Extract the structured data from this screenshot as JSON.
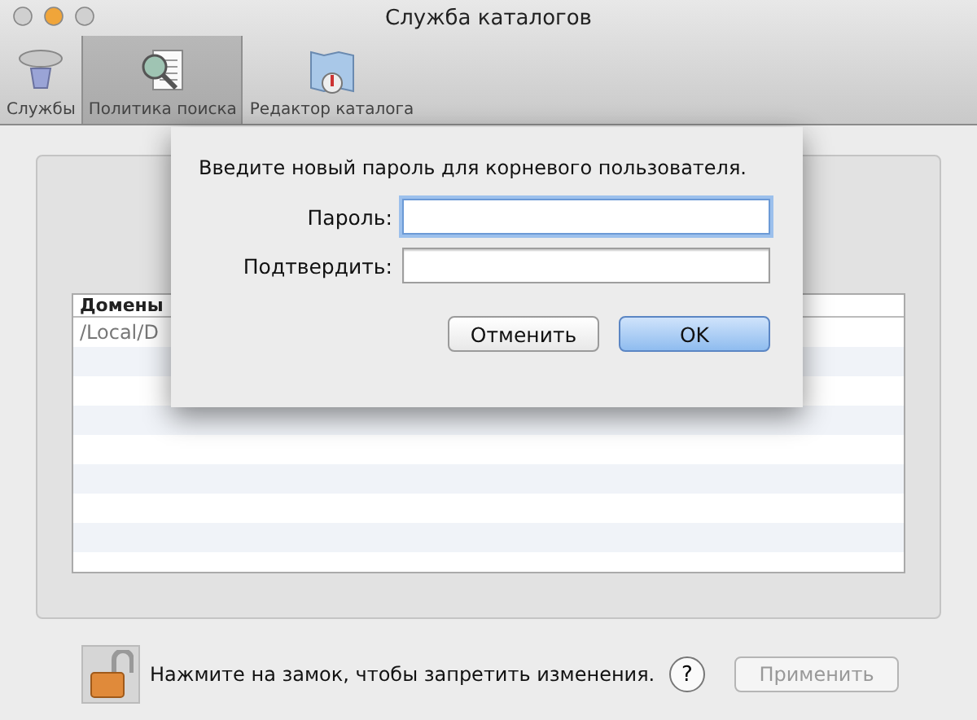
{
  "window": {
    "title": "Служба каталогов"
  },
  "toolbar": [
    {
      "label": "Службы",
      "selected": false,
      "kind": "services"
    },
    {
      "label": "Политика поиска",
      "selected": true,
      "kind": "search"
    },
    {
      "label": "Редактор каталога",
      "selected": false,
      "kind": "editor"
    }
  ],
  "table": {
    "columns": [
      "Домены"
    ],
    "rows": [
      "/Local/D"
    ]
  },
  "dialog": {
    "message": "Введите новый пароль для корневого пользователя.",
    "fields": [
      {
        "label": "Пароль:",
        "focused": true
      },
      {
        "label": "Подтвердить:",
        "focused": false
      }
    ],
    "buttons": [
      {
        "label": "Отменить",
        "primary": false
      },
      {
        "label": "OK",
        "primary": true
      }
    ]
  },
  "footer": {
    "locked": false,
    "text": "Нажмите на замок, чтобы запретить изменения.",
    "help": "?",
    "apply": {
      "label": "Применить",
      "disabled": true
    }
  }
}
